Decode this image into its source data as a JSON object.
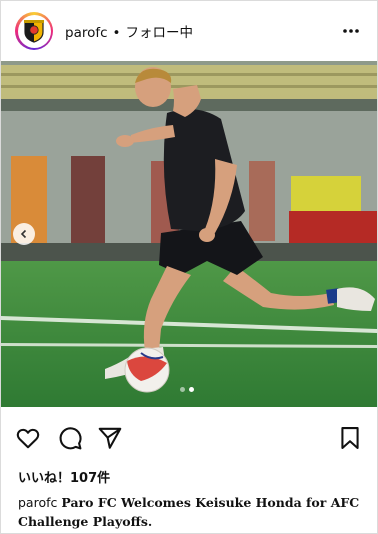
{
  "header": {
    "username": "parofc",
    "separator": "•",
    "follow_status": "フォロー中",
    "more_icon": "more-horizontal-icon"
  },
  "post": {
    "carousel": {
      "slide_count": 2,
      "active_slide": 2
    },
    "prev_icon": "chevron-left-icon"
  },
  "actions": {
    "like_icon": "heart-icon",
    "comment_icon": "comment-bubble-icon",
    "share_icon": "paper-plane-icon",
    "save_icon": "bookmark-icon"
  },
  "likes": {
    "text": "いいね！107件"
  },
  "caption": {
    "username": "parofc",
    "text": "Paro FC Welcomes Keisuke Honda for AFC Challenge Playoffs."
  },
  "colors": {
    "pitch": "#3f8a3c",
    "shirt": "#1c1d21",
    "ball_accent": "#d8342b"
  }
}
